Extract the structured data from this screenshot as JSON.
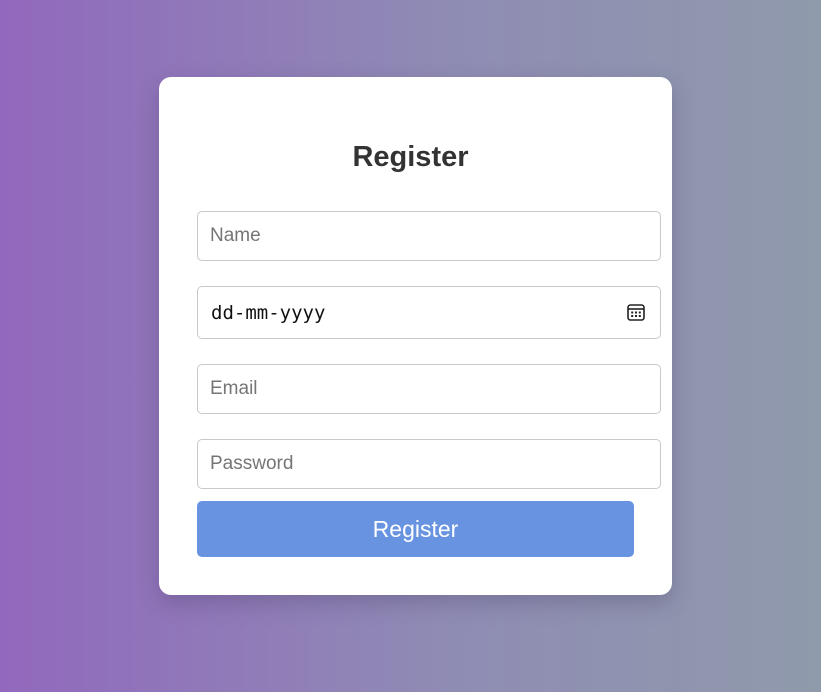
{
  "form": {
    "title": "Register",
    "name_placeholder": "Name",
    "date_placeholder": "dd-mm-yyyy",
    "email_placeholder": "Email",
    "password_placeholder": "Password",
    "submit_label": "Register",
    "calendar_icon": "calendar-icon"
  },
  "colors": {
    "background_gradient_start": "#9168bd",
    "background_gradient_end": "#8f9aab",
    "card": "#ffffff",
    "button": "#6793e0",
    "title_text": "#333333"
  }
}
